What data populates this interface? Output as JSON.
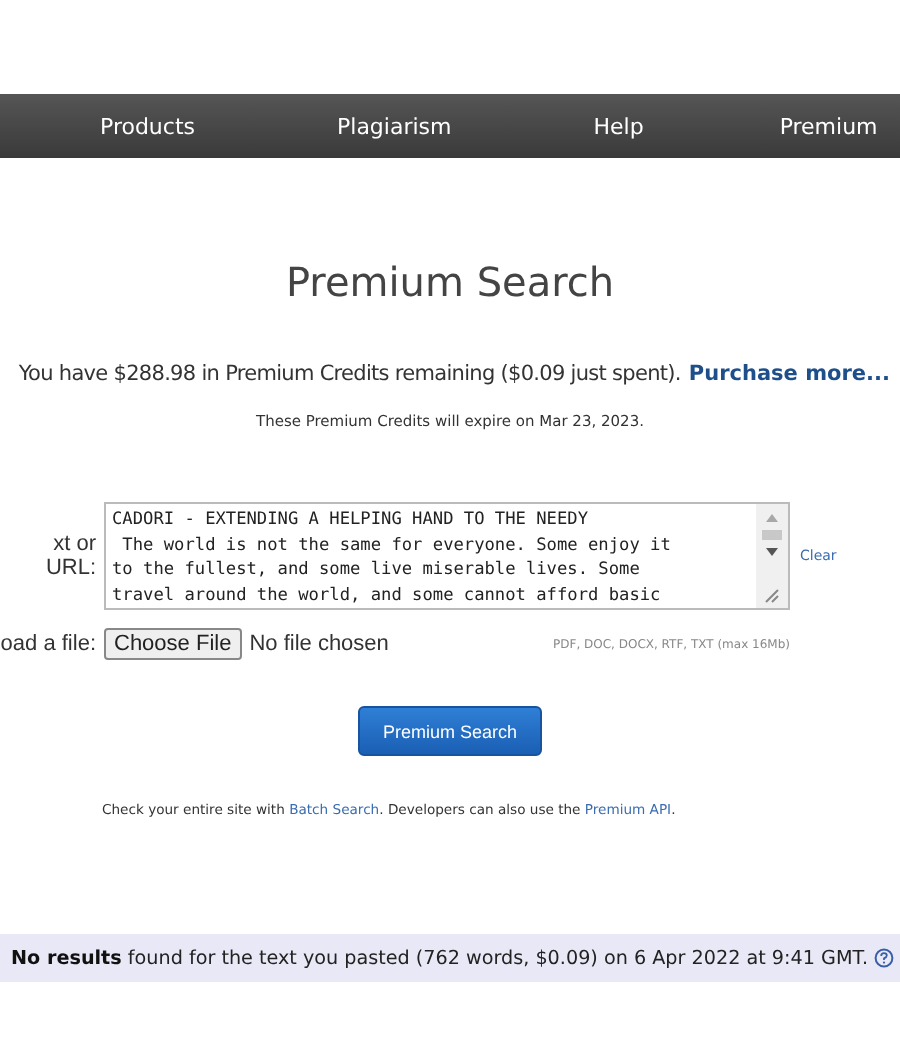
{
  "nav": {
    "items": [
      "Products",
      "Plagiarism",
      "Help",
      "Premium"
    ]
  },
  "title": "Premium Search",
  "credits": {
    "text": "You have $288.98 in Premium Credits remaining ($0.09 just spent).",
    "link": "Purchase more..."
  },
  "expiry": "These Premium Credits will expire on Mar 23, 2023.",
  "text_field": {
    "label": "xt or URL:",
    "value_lines": [
      "CADORI - EXTENDING A HELPING HAND TO THE NEEDY",
      " The world is not the same for everyone. Some enjoy it",
      "to the fullest, and some live miserable lives. Some",
      "travel around the world, and some cannot afford basic"
    ],
    "clear": "Clear"
  },
  "file_field": {
    "label": "oad a file:",
    "button": "Choose File",
    "status": "No file chosen",
    "hint": "PDF, DOC, DOCX, RTF, TXT (max 16Mb)"
  },
  "search_button": "Premium Search",
  "footer": {
    "before": "Check your entire site with",
    "link1": "Batch Search",
    "middle": ". Developers can also use the",
    "link2": "Premium API",
    "after": "."
  },
  "result": {
    "bold": "No results",
    "text": "found for the text you pasted (762 words, $0.09) on 6 Apr 2022 at 9:41 GMT."
  }
}
